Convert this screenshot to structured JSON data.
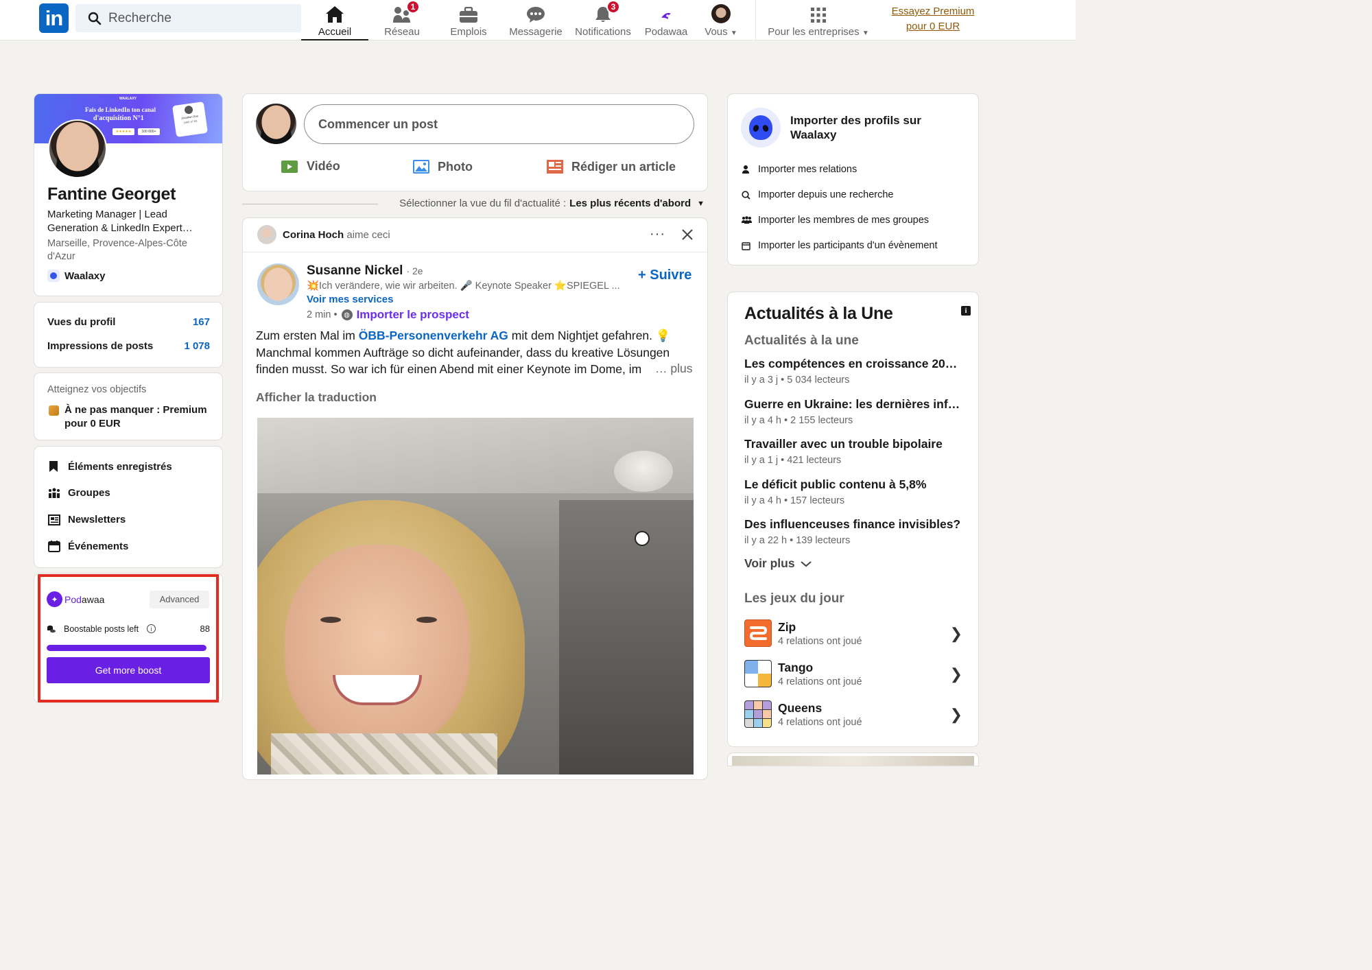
{
  "nav": {
    "logo": "in",
    "search_placeholder": "Recherche",
    "items": [
      {
        "label": "Accueil",
        "icon": "home-icon"
      },
      {
        "label": "Réseau",
        "icon": "network-icon",
        "badge": "1"
      },
      {
        "label": "Emplois",
        "icon": "briefcase-icon"
      },
      {
        "label": "Messagerie",
        "icon": "messaging-icon"
      },
      {
        "label": "Notifications",
        "icon": "bell-icon",
        "badge": "3"
      },
      {
        "label": "Podawaa",
        "icon": "podawaa-icon"
      },
      {
        "label": "Vous",
        "icon": "avatar"
      }
    ],
    "business": "Pour les entreprises",
    "premium_line1": "Essayez Premium",
    "premium_line2": "pour 0 EUR"
  },
  "profile": {
    "banner_brand": "WAALAXY",
    "banner_line1": "Fais de LinkedIn ton canal",
    "banner_line2": "d'acquisition N°1",
    "banner_chip": "100 000+",
    "banner_mini_name": "Jonathan Doe",
    "banner_mini_stats": [
      "1000",
      "47",
      "83"
    ],
    "name": "Fantine Georget",
    "headline": "Marketing Manager | Lead Generation & LinkedIn Expert…",
    "location": "Marseille, Provence-Alpes-Côte d'Azur",
    "company": "Waalaxy"
  },
  "stats": [
    {
      "label": "Vues du profil",
      "value": "167"
    },
    {
      "label": "Impressions de posts",
      "value": "1 078"
    }
  ],
  "goals": {
    "title": "Atteignez vos objectifs",
    "text": "À ne pas manquer : Premium pour 0 EUR"
  },
  "shortcuts": [
    {
      "label": "Éléments enregistrés",
      "icon": "bookmark-icon"
    },
    {
      "label": "Groupes",
      "icon": "groups-icon"
    },
    {
      "label": "Newsletters",
      "icon": "newsletter-icon"
    },
    {
      "label": "Événements",
      "icon": "calendar-icon"
    }
  ],
  "podawaa_widget": {
    "brand_pod": "Pod",
    "brand_awaa": "awaa",
    "plan": "Advanced",
    "posts_left_label": "Boostable posts left",
    "posts_left": "88",
    "progress": 1.0,
    "cta": "Get more boost",
    "accent": "#6a1fe4",
    "highlight": "#e32b1f"
  },
  "composer": {
    "placeholder": "Commencer un post",
    "actions": [
      {
        "label": "Vidéo",
        "icon": "video-icon",
        "color": "#5f9b41"
      },
      {
        "label": "Photo",
        "icon": "photo-icon",
        "color": "#378fe9"
      },
      {
        "label": "Rédiger un article",
        "icon": "article-icon",
        "color": "#e06847"
      }
    ]
  },
  "feed_sort": {
    "label": "Sélectionner la vue du fil d'actualité :",
    "value": "Les plus récents d'abord"
  },
  "post": {
    "liker_name": "Corina Hoch",
    "liker_action": "aime ceci",
    "author": "Susanne Nickel",
    "degree": "· 2e",
    "author_headline": "💥Ich verändere, wie wir arbeiten. 🎤 Keynote Speaker ⭐SPIEGEL ...",
    "services": "Voir mes services",
    "time": "2 min •",
    "import_prospect": "Importer le prospect",
    "follow": "+ Suivre",
    "text_before": "Zum ersten Mal im ",
    "text_link": "ÖBB-Personenverkehr AG",
    "text_after": " mit dem Nightjet gefahren. 💡 Manchmal kommen Aufträge so dicht aufeinander, dass du kreative Lösungen finden musst. So war ich für einen Abend mit einer Keynote im Dome, im",
    "more": "… plus",
    "translate": "Afficher la traduction"
  },
  "waalaxy_import": {
    "title": "Importer des profils sur Waalaxy",
    "items": [
      {
        "label": "Importer mes relations",
        "icon": "person-icon"
      },
      {
        "label": "Importer depuis une recherche",
        "icon": "search-icon"
      },
      {
        "label": "Importer les membres de mes groupes",
        "icon": "group-icon"
      },
      {
        "label": "Importer les participants d'un évènement",
        "icon": "calendar-icon"
      }
    ]
  },
  "news": {
    "title": "Actualités à la Une",
    "subtitle": "Actualités à la une",
    "items": [
      {
        "title": "Les compétences en croissance 20…",
        "meta": "il y a 3 j • 5 034 lecteurs"
      },
      {
        "title": "Guerre en Ukraine: les dernières inf…",
        "meta": "il y a 4 h • 2 155 lecteurs"
      },
      {
        "title": "Travailler avec un trouble bipolaire",
        "meta": "il y a 1 j • 421 lecteurs"
      },
      {
        "title": "Le déficit public contenu à 5,8%",
        "meta": "il y a 4 h • 157 lecteurs"
      },
      {
        "title": "Des influenceuses finance invisibles?",
        "meta": "il y a 22 h • 139 lecteurs"
      }
    ],
    "see_more": "Voir plus"
  },
  "games": {
    "title": "Les jeux du jour",
    "items": [
      {
        "name": "Zip",
        "meta": "4 relations ont joué",
        "icon": "zip-game-icon"
      },
      {
        "name": "Tango",
        "meta": "4 relations ont joué",
        "icon": "tango-game-icon"
      },
      {
        "name": "Queens",
        "meta": "4 relations ont joué",
        "icon": "queens-game-icon"
      }
    ]
  }
}
